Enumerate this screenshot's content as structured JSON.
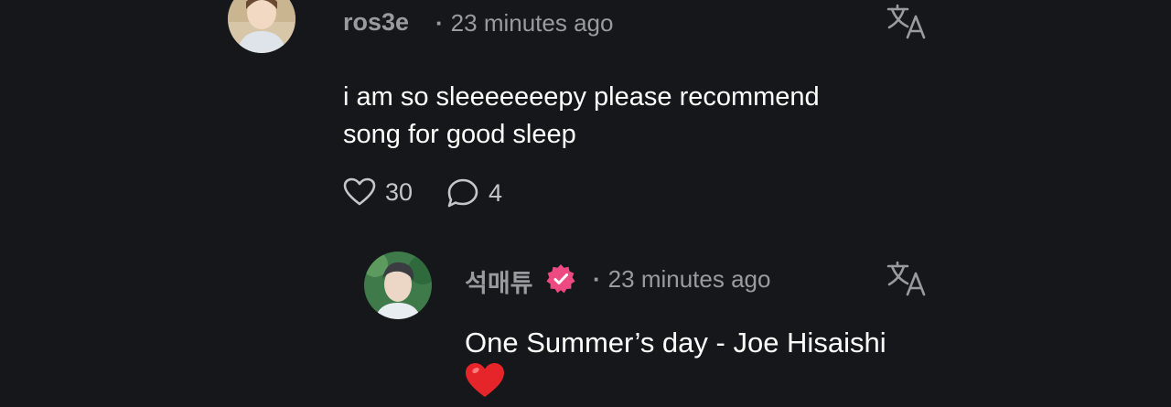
{
  "comment": {
    "username": "ros3e",
    "separator": "·",
    "time": "23 minutes ago",
    "text_line1": "i am so sleeeeeeepy please recommend",
    "text_line2": "song for good sleep",
    "likes": "30",
    "replies": "4"
  },
  "reply": {
    "username": "석매튜",
    "verified": true,
    "separator": "·",
    "time": "23 minutes ago",
    "text_line1": "One Summer’s day - Joe Hisaishi",
    "emoji": "❤️"
  },
  "colors": {
    "background": "#16171a",
    "muted": "#9a9ba0",
    "verified_badge": "#ec4a80",
    "heart": "#e5252a"
  },
  "icons": {
    "translate": "translate-icon",
    "like": "heart-outline-icon",
    "reply": "chat-bubble-icon",
    "verified": "verified-badge-icon"
  }
}
